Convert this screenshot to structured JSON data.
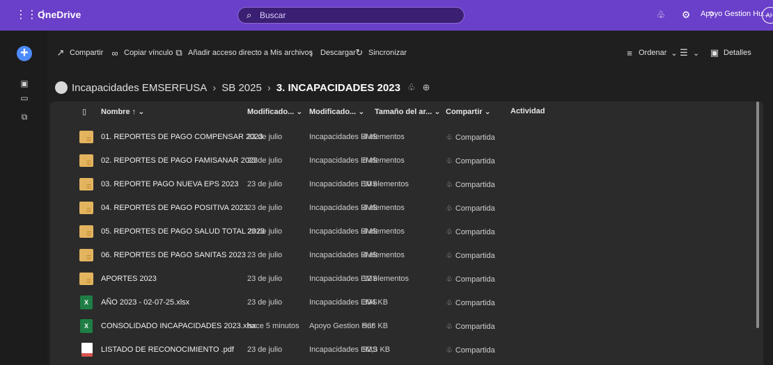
{
  "app": {
    "title": "OneDrive",
    "search_placeholder": "Buscar",
    "user": "Apoyo Gestion Hu...",
    "avatar": "AH"
  },
  "commands": [
    {
      "label": "Compartir",
      "icon": "share-icon"
    },
    {
      "label": "Copiar vínculo",
      "icon": "link-icon"
    },
    {
      "label": "Añadir acceso directo a Mis archivos",
      "icon": "shortcut-icon"
    },
    {
      "label": "Descargar",
      "icon": "download-icon"
    },
    {
      "label": "Sincronizar",
      "icon": "sync-icon"
    }
  ],
  "view_controls": [
    {
      "label": "Ordenar",
      "icon": "sort-icon"
    },
    {
      "label": "",
      "icon": "view-icon"
    },
    {
      "label": "Detalles",
      "icon": "details-icon"
    }
  ],
  "breadcrumb": [
    "Incapacidades EMSERFUSA",
    "SB 2025",
    "3. INCAPACIDADES 2023"
  ],
  "table": {
    "headers": [
      "Nombre ↑",
      "Modificado...",
      "Modificado...",
      "Tamaño del ar...",
      "Compartir",
      "Actividad"
    ],
    "rows": [
      {
        "type": "folder",
        "name": "01. REPORTES DE PAGO COMPENSAR 2023",
        "modified": "23 de julio",
        "modified_by": "Incapacidades EMS",
        "size": "4 elementos",
        "sharing": "Compartida"
      },
      {
        "type": "folder",
        "name": "02. REPORTES DE PAGO FAMISANAR 2023",
        "modified": "23 de julio",
        "modified_by": "Incapacidades EMS",
        "size": "6 elementos",
        "sharing": "Compartida"
      },
      {
        "type": "folder",
        "name": "03. REPORTE PAGO NUEVA EPS 2023",
        "modified": "23 de julio",
        "modified_by": "Incapacidades EMS",
        "size": "10 elementos",
        "sharing": "Compartida"
      },
      {
        "type": "folder",
        "name": "04. REPORTES DE PAGO POSITIVA 2023",
        "modified": "23 de julio",
        "modified_by": "Incapacidades EMS",
        "size": "4 elementos",
        "sharing": "Compartida"
      },
      {
        "type": "folder",
        "name": "05. REPORTES DE PAGO SALUD TOTAL 2023",
        "modified": "23 de julio",
        "modified_by": "Incapacidades EMS",
        "size": "4 elementos",
        "sharing": "Compartida"
      },
      {
        "type": "folder",
        "name": "06. REPORTES DE PAGO SANITAS 2023",
        "modified": "23 de julio",
        "modified_by": "Incapacidades EMS",
        "size": "4 elementos",
        "sharing": "Compartida"
      },
      {
        "type": "folder",
        "name": "APORTES 2023",
        "modified": "23 de julio",
        "modified_by": "Incapacidades EMS",
        "size": "12 elementos",
        "sharing": "Compartida"
      },
      {
        "type": "xlsx",
        "name": "AÑO 2023 - 02-07-25.xlsx",
        "modified": "23 de julio",
        "modified_by": "Incapacidades EMS",
        "size": "394 KB",
        "sharing": "Compartida"
      },
      {
        "type": "xlsx",
        "name": "CONSOLIDADO INCAPACIDADES 2023.xlsx",
        "modified": "hace 5 minutos",
        "modified_by": "Apoyo Gestion Hur",
        "size": "568 KB",
        "sharing": "Compartida"
      },
      {
        "type": "pdf",
        "name": "LISTADO DE RECONOCIMIENTO .pdf",
        "modified": "23 de julio",
        "modified_by": "Incapacidades EMS",
        "size": "92,3 KB",
        "sharing": "Compartida"
      }
    ]
  }
}
